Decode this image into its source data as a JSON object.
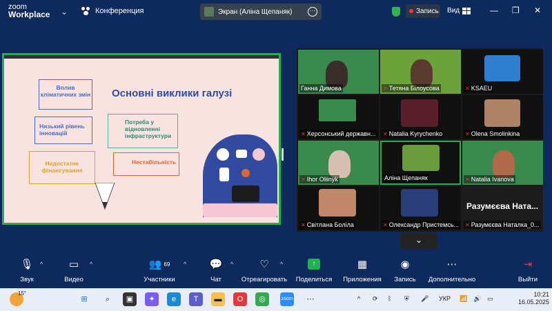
{
  "titlebar": {
    "brand_line1": "zoom",
    "brand_line2": "Workplace",
    "conference_label": "Конференция",
    "screen_share_label": "Экран (Аліна Щепаняк)",
    "record_label": "Запись",
    "view_label": "Вид"
  },
  "slide": {
    "title": "Основні виклики галузі",
    "items": [
      "Вплив кліматичних змін",
      "Низький рівень інновацій",
      "Недостатнє фінансування",
      "Потреба у відновленні інфраструктури",
      "Нестабільність"
    ]
  },
  "participants": [
    {
      "name": "Ганна Димова",
      "muted": false
    },
    {
      "name": "Тетяна Білоусова",
      "muted": true
    },
    {
      "name": "KSAEU",
      "muted": true
    },
    {
      "name": "Херсонський державн...",
      "muted": true
    },
    {
      "name": "Natalia Kyrychenko",
      "muted": true
    },
    {
      "name": "Olena Smolinkina",
      "muted": true
    },
    {
      "name": "Ihor Oliinyk",
      "muted": true
    },
    {
      "name": "Аліна Щепаняк",
      "muted": false
    },
    {
      "name": "Natalia Ivanova",
      "muted": true
    },
    {
      "name": "Світлана Боліла",
      "muted": true
    },
    {
      "name": "Олександр Пристемсь...",
      "muted": true
    },
    {
      "name": "Разумєєва Наталка_0...",
      "muted": true
    }
  ],
  "tile_big_name": "Разумєєва Ната...",
  "toolbar": {
    "audio": "Звук",
    "video": "Видео",
    "participants": "Участники",
    "participants_count": "69",
    "chat": "Чат",
    "react": "Отреагировать",
    "share": "Поделиться",
    "apps": "Приложения",
    "record": "Запись",
    "more": "Дополнительно",
    "exit": "Выйти"
  },
  "taskbar": {
    "weather_temp": "15°",
    "language": "УКР",
    "time": "10:21",
    "date": "16.05.2025"
  }
}
